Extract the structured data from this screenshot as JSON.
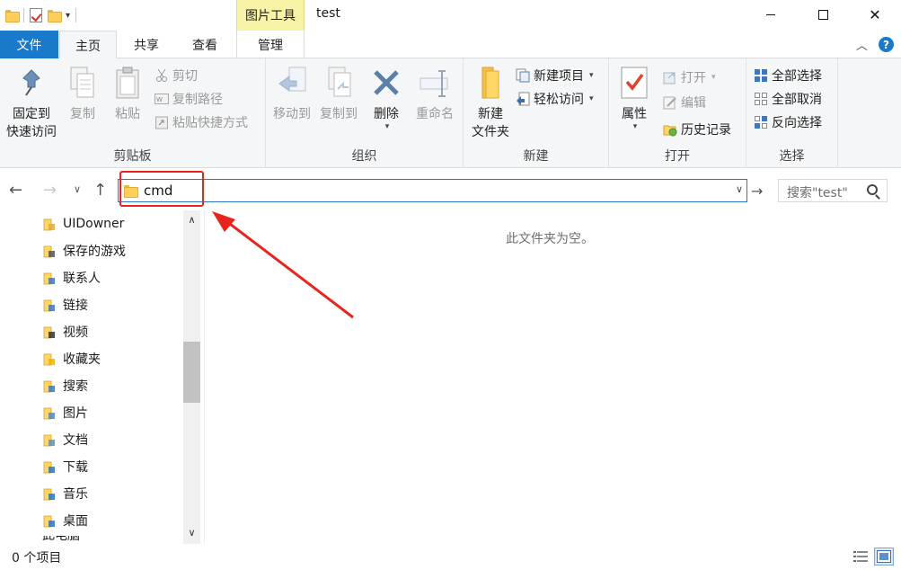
{
  "window": {
    "title": "test",
    "contextual_tab_title": "图片工具",
    "minimize": "minimize",
    "maximize": "maximize",
    "close": "✕"
  },
  "ribbon_tabs": {
    "file": "文件",
    "home": "主页",
    "share": "共享",
    "view": "查看",
    "manage": "管理",
    "help": "?"
  },
  "clipboard": {
    "pin_line1": "固定到",
    "pin_line2": "快速访问",
    "copy": "复制",
    "paste": "粘贴",
    "cut": "剪切",
    "copy_path": "复制路径",
    "paste_shortcut": "粘贴快捷方式",
    "label": "剪贴板"
  },
  "organize": {
    "move_to": "移动到",
    "copy_to": "复制到",
    "delete": "删除",
    "rename": "重命名",
    "label": "组织"
  },
  "new": {
    "new_folder_line1": "新建",
    "new_folder_line2": "文件夹",
    "new_item": "新建项目",
    "easy_access": "轻松访问",
    "label": "新建"
  },
  "open": {
    "properties": "属性",
    "open": "打开",
    "edit": "编辑",
    "history": "历史记录",
    "label": "打开"
  },
  "select": {
    "select_all": "全部选择",
    "select_none": "全部取消",
    "invert": "反向选择",
    "label": "选择"
  },
  "address": {
    "path": "cmd",
    "search_placeholder": "搜索\"test\""
  },
  "nav_items": [
    {
      "label": "UIDowner",
      "icon": "folder-icon"
    },
    {
      "label": "保存的游戏",
      "icon": "saved-games-icon"
    },
    {
      "label": "联系人",
      "icon": "contacts-icon"
    },
    {
      "label": "链接",
      "icon": "links-icon"
    },
    {
      "label": "视频",
      "icon": "videos-icon"
    },
    {
      "label": "收藏夹",
      "icon": "favorites-icon"
    },
    {
      "label": "搜索",
      "icon": "searches-icon"
    },
    {
      "label": "图片",
      "icon": "pictures-icon"
    },
    {
      "label": "文档",
      "icon": "documents-icon"
    },
    {
      "label": "下载",
      "icon": "downloads-icon"
    },
    {
      "label": "音乐",
      "icon": "music-icon"
    },
    {
      "label": "桌面",
      "icon": "desktop-icon"
    }
  ],
  "nav_cut_label": "此电脑",
  "content": {
    "empty_message": "此文件夹为空。"
  },
  "status": {
    "item_count": "0 个项目"
  },
  "colors": {
    "accent": "#1979ca",
    "contextual_tab": "#f7f2a5",
    "annotation_red": "#e8251d"
  }
}
